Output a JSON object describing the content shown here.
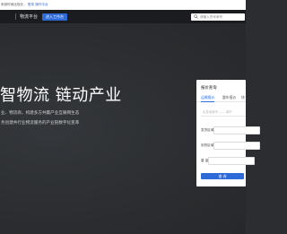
{
  "notice": {
    "text": "系统时间比较长，",
    "link1": "登录",
    "link2": "操作平台"
  },
  "header": {
    "brand": "物流平台",
    "enter_button": "进入工作台",
    "search_placeholder": "请输入货号单号"
  },
  "hero": {
    "headline": "智物流 链动产业",
    "desc_line1": "业、物流商，构建多方共赢产业互联网生态",
    "desc_line2": "务创建共行业物流服务的产业链数字化变革"
  },
  "quote_card": {
    "title": "报价查询",
    "tabs": [
      "运输报价",
      "整车报价",
      "快"
    ],
    "active_tab": 0,
    "fields": [
      {
        "label": "",
        "placeholder": "出发地城市 —— 城市"
      },
      {
        "label": "发货区域",
        "placeholder": ""
      },
      {
        "label": "到货区域",
        "placeholder": ""
      },
      {
        "label": "重    量",
        "placeholder": ""
      }
    ],
    "submit": "查 询"
  },
  "colors": {
    "accent": "#2f6bd8",
    "header_bg": "#1a1c1f",
    "hero_bg": "#2b2d30"
  }
}
